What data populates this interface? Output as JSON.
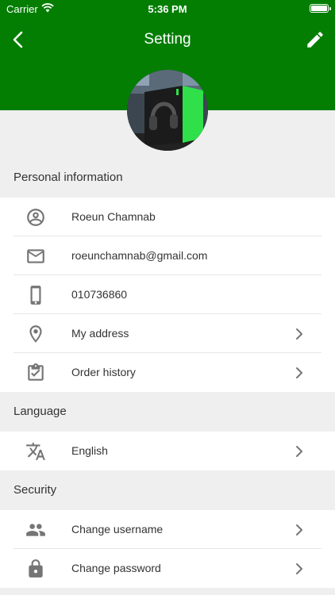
{
  "status_bar": {
    "carrier": "Carrier",
    "time": "5:36 PM"
  },
  "nav": {
    "title": "Setting"
  },
  "colors": {
    "header": "#037e03",
    "accent": "#2fe04a",
    "icon": "#757575"
  },
  "sections": {
    "personal": {
      "title": "Personal information",
      "rows": [
        {
          "label": "Roeun Chamnab",
          "icon": "account-circle-icon"
        },
        {
          "label": "roeunchamnab@gmail.com",
          "icon": "mail-icon"
        },
        {
          "label": "010736860",
          "icon": "phone-icon"
        },
        {
          "label": "My address",
          "icon": "location-pin-icon"
        },
        {
          "label": "Order history",
          "icon": "clipboard-check-icon"
        }
      ]
    },
    "language": {
      "title": "Language",
      "rows": [
        {
          "label": "English",
          "icon": "translate-icon"
        }
      ]
    },
    "security": {
      "title": "Security",
      "rows": [
        {
          "label": "Change username",
          "icon": "people-icon"
        },
        {
          "label": "Change password",
          "icon": "lock-icon"
        }
      ]
    }
  }
}
